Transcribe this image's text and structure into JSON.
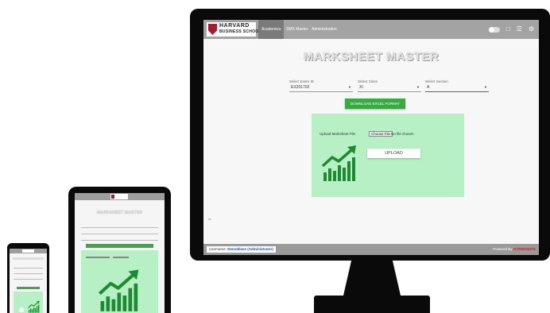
{
  "app": {
    "logo_line1": "HARVARD",
    "logo_line2": "BUSINESS SCHOOL"
  },
  "nav": {
    "tabs": [
      {
        "label": "Academics",
        "active": true
      },
      {
        "label": "SMS Master",
        "active": false
      },
      {
        "label": "Administration",
        "active": false
      }
    ],
    "icons": [
      "toggle-switch",
      "lock-icon",
      "menu-icon",
      "gear-icon"
    ]
  },
  "page": {
    "title": "MARKSHEET MASTER"
  },
  "form": {
    "exam": {
      "label": "Select Exam ID",
      "value": "EX201702"
    },
    "class": {
      "label": "Select Class",
      "value": "XI"
    },
    "section": {
      "label": "Select Section",
      "value": "A"
    },
    "download_button": "DOWNLOAD EXCEL FORMAT"
  },
  "upload": {
    "label": "Upload Marksheet File",
    "choose_button": "Choose File",
    "no_file_text": "No file chosen",
    "upload_button": "UPLOAD"
  },
  "status_text": "ss",
  "footer": {
    "username_label": "Username:",
    "username_value": "Demoklass (Administrator)",
    "powered_by": "Powered By",
    "powered_brand": "GYANOSUTE"
  },
  "colors": {
    "nav_bg": "#a3a3a3",
    "accent_green": "#39a845",
    "panel_green": "#b6f0c4",
    "chart_green": "#1e8a32",
    "link_blue": "#1a47c4",
    "brand_red": "#d01717"
  }
}
